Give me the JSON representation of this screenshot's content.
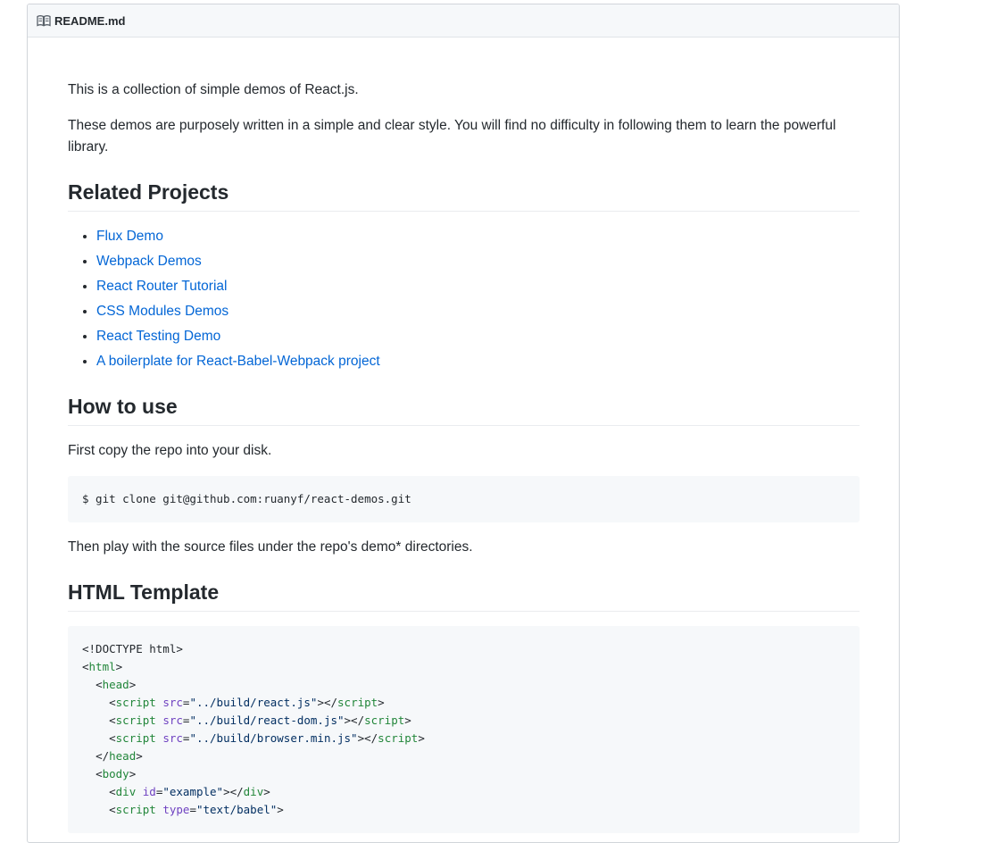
{
  "header": {
    "icon": "book-icon",
    "title": "README.md"
  },
  "intro": {
    "p1": "This is a collection of simple demos of React.js.",
    "p2": "These demos are purposely written in a simple and clear style. You will find no difficulty in following them to learn the powerful library."
  },
  "related": {
    "heading": "Related Projects",
    "items": [
      {
        "label": "Flux Demo"
      },
      {
        "label": "Webpack Demos"
      },
      {
        "label": "React Router Tutorial"
      },
      {
        "label": "CSS Modules Demos"
      },
      {
        "label": "React Testing Demo"
      },
      {
        "label": "A boilerplate for React-Babel-Webpack project"
      }
    ]
  },
  "how_to_use": {
    "heading": "How to use",
    "p1": "First copy the repo into your disk.",
    "code": "$ git clone git@github.com:ruanyf/react-demos.git",
    "p2": "Then play with the source files under the repo's demo* directories."
  },
  "html_template": {
    "heading": "HTML Template",
    "code_lines": [
      {
        "indent": "",
        "parts": [
          {
            "t": "plain",
            "v": "<!DOCTYPE html>"
          }
        ]
      },
      {
        "indent": "",
        "parts": [
          {
            "t": "plain",
            "v": "<"
          },
          {
            "t": "tag",
            "v": "html"
          },
          {
            "t": "plain",
            "v": ">"
          }
        ]
      },
      {
        "indent": "  ",
        "parts": [
          {
            "t": "plain",
            "v": "<"
          },
          {
            "t": "tag",
            "v": "head"
          },
          {
            "t": "plain",
            "v": ">"
          }
        ]
      },
      {
        "indent": "    ",
        "parts": [
          {
            "t": "plain",
            "v": "<"
          },
          {
            "t": "tag",
            "v": "script"
          },
          {
            "t": "plain",
            "v": " "
          },
          {
            "t": "attr",
            "v": "src"
          },
          {
            "t": "plain",
            "v": "="
          },
          {
            "t": "str",
            "v": "\"../build/react.js\""
          },
          {
            "t": "plain",
            "v": "></"
          },
          {
            "t": "tag",
            "v": "script"
          },
          {
            "t": "plain",
            "v": ">"
          }
        ]
      },
      {
        "indent": "    ",
        "parts": [
          {
            "t": "plain",
            "v": "<"
          },
          {
            "t": "tag",
            "v": "script"
          },
          {
            "t": "plain",
            "v": " "
          },
          {
            "t": "attr",
            "v": "src"
          },
          {
            "t": "plain",
            "v": "="
          },
          {
            "t": "str",
            "v": "\"../build/react-dom.js\""
          },
          {
            "t": "plain",
            "v": "></"
          },
          {
            "t": "tag",
            "v": "script"
          },
          {
            "t": "plain",
            "v": ">"
          }
        ]
      },
      {
        "indent": "    ",
        "parts": [
          {
            "t": "plain",
            "v": "<"
          },
          {
            "t": "tag",
            "v": "script"
          },
          {
            "t": "plain",
            "v": " "
          },
          {
            "t": "attr",
            "v": "src"
          },
          {
            "t": "plain",
            "v": "="
          },
          {
            "t": "str",
            "v": "\"../build/browser.min.js\""
          },
          {
            "t": "plain",
            "v": "></"
          },
          {
            "t": "tag",
            "v": "script"
          },
          {
            "t": "plain",
            "v": ">"
          }
        ]
      },
      {
        "indent": "  ",
        "parts": [
          {
            "t": "plain",
            "v": "</"
          },
          {
            "t": "tag",
            "v": "head"
          },
          {
            "t": "plain",
            "v": ">"
          }
        ]
      },
      {
        "indent": "  ",
        "parts": [
          {
            "t": "plain",
            "v": "<"
          },
          {
            "t": "tag",
            "v": "body"
          },
          {
            "t": "plain",
            "v": ">"
          }
        ]
      },
      {
        "indent": "    ",
        "parts": [
          {
            "t": "plain",
            "v": "<"
          },
          {
            "t": "tag",
            "v": "div"
          },
          {
            "t": "plain",
            "v": " "
          },
          {
            "t": "attr",
            "v": "id"
          },
          {
            "t": "plain",
            "v": "="
          },
          {
            "t": "str",
            "v": "\"example\""
          },
          {
            "t": "plain",
            "v": "></"
          },
          {
            "t": "tag",
            "v": "div"
          },
          {
            "t": "plain",
            "v": ">"
          }
        ]
      },
      {
        "indent": "    ",
        "parts": [
          {
            "t": "plain",
            "v": "<"
          },
          {
            "t": "tag",
            "v": "script"
          },
          {
            "t": "plain",
            "v": " "
          },
          {
            "t": "attr",
            "v": "type"
          },
          {
            "t": "plain",
            "v": "="
          },
          {
            "t": "str",
            "v": "\"text/babel\""
          },
          {
            "t": "plain",
            "v": ">"
          }
        ]
      }
    ]
  },
  "colors": {
    "link": "#0366d6",
    "text": "#24292e",
    "code_bg": "#f6f8fa",
    "tag": "#22863a",
    "attr": "#6f42c1",
    "string": "#032f62"
  }
}
